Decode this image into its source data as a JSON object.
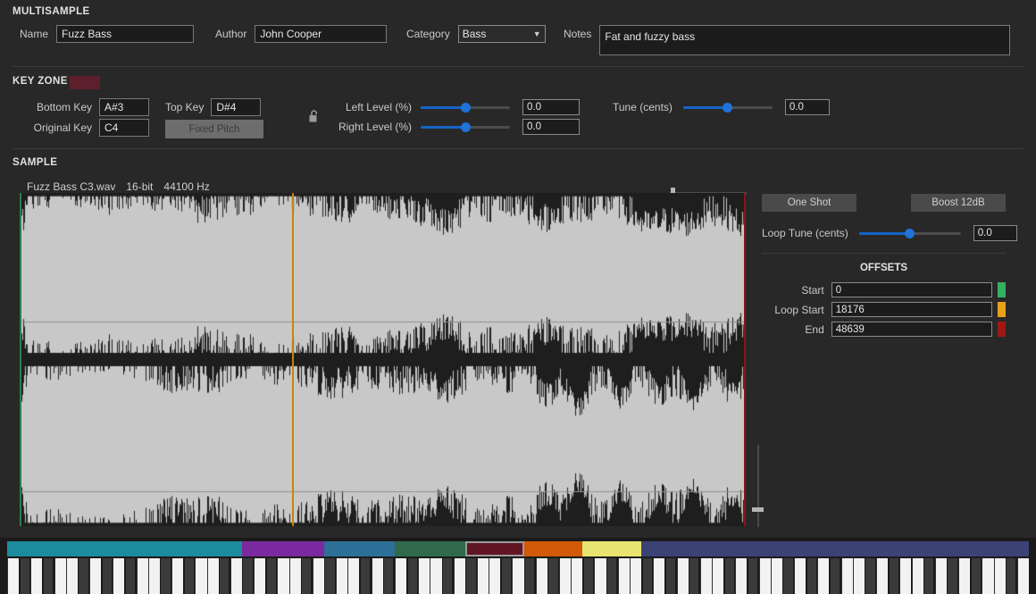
{
  "multisample": {
    "section_label": "MULTISAMPLE",
    "name_label": "Name",
    "name_value": "Fuzz Bass",
    "author_label": "Author",
    "author_value": "John Cooper",
    "category_label": "Category",
    "category_value": "Bass",
    "category_options": [
      "Bass"
    ],
    "notes_label": "Notes",
    "notes_value": "Fat and fuzzy bass"
  },
  "key_zone": {
    "section_label": "KEY ZONE",
    "zone_color": "#5d1f2b",
    "bottom_key_label": "Bottom Key",
    "bottom_key_value": "A#3",
    "original_key_label": "Original Key",
    "original_key_value": "C4",
    "top_key_label": "Top Key",
    "top_key_value": "D#4",
    "fixed_pitch_label": "Fixed Pitch",
    "lock_icon": "padlock-open-icon",
    "left_level_label": "Left Level (%)",
    "left_level_value": "0.0",
    "left_level_pct": 50,
    "right_level_label": "Right Level (%)",
    "right_level_value": "0.0",
    "right_level_pct": 50,
    "tune_label": "Tune (cents)",
    "tune_value": "0.0",
    "tune_pct": 50
  },
  "sample": {
    "section_label": "SAMPLE",
    "file_name": "Fuzz Bass C3.wav",
    "bit_depth": "16-bit",
    "sample_rate": "44100 Hz",
    "one_shot_label": "One Shot",
    "boost_label": "Boost 12dB",
    "loop_tune_label": "Loop Tune (cents)",
    "loop_tune_value": "0.0",
    "loop_tune_pct": 50,
    "offsets_label": "OFFSETS",
    "offsets": [
      {
        "label": "Start",
        "value": "0",
        "color": "#35b162"
      },
      {
        "label": "Loop Start",
        "value": "18176",
        "color": "#e8a01a"
      },
      {
        "label": "End",
        "value": "48639",
        "color": "#a01814"
      }
    ],
    "marker_colors": {
      "start": "#2e7d4f",
      "loop_start": "#c8820e",
      "end": "#8c1410"
    },
    "waveform_color": "#c8c8c8",
    "waveform_bg": "#1e1e1e"
  },
  "keyboard": {
    "zones": [
      {
        "color": "#1d8b9e",
        "start": 0,
        "keys": 20,
        "selected": false
      },
      {
        "color": "#7a2a9e",
        "start": 20,
        "keys": 7,
        "selected": false
      },
      {
        "color": "#2d6f96",
        "start": 27,
        "keys": 6,
        "selected": false
      },
      {
        "color": "#2f6b4a",
        "start": 33,
        "keys": 6,
        "selected": false
      },
      {
        "color": "#611624",
        "start": 39,
        "keys": 5,
        "selected": true
      },
      {
        "color": "#d05a07",
        "start": 44,
        "keys": 5,
        "selected": false
      },
      {
        "color": "#e8e472",
        "start": 49,
        "keys": 5,
        "selected": false
      },
      {
        "color": "#3c4276",
        "start": 54,
        "keys": 33,
        "selected": false
      }
    ],
    "highlighted_key_index": 41,
    "total_keys": 87
  }
}
